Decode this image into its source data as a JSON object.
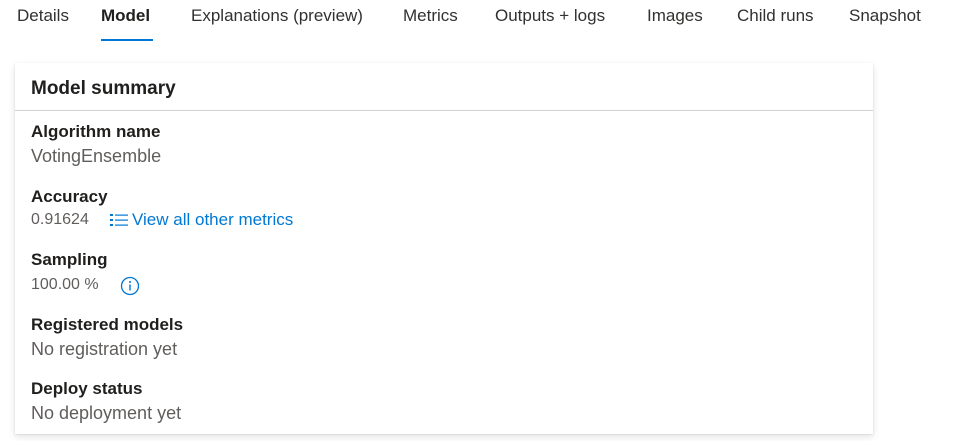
{
  "tabs": [
    {
      "label": "Details"
    },
    {
      "label": "Model"
    },
    {
      "label": "Explanations (preview)"
    },
    {
      "label": "Metrics"
    },
    {
      "label": "Outputs + logs"
    },
    {
      "label": "Images"
    },
    {
      "label": "Child runs"
    },
    {
      "label": "Snapshot"
    }
  ],
  "active_tab": "Model",
  "colors": {
    "accent": "#0078d4",
    "text": "#323130",
    "muted": "#605e5c"
  },
  "model_summary": {
    "title": "Model summary",
    "algorithm": {
      "label": "Algorithm name",
      "value": "VotingEnsemble"
    },
    "accuracy": {
      "label": "Accuracy",
      "value": "0.91624",
      "link_label": "View all other metrics",
      "link_icon": "bulleted-list-icon"
    },
    "sampling": {
      "label": "Sampling",
      "value": "100.00 %",
      "info_icon": "info-icon"
    },
    "registered_models": {
      "label": "Registered models",
      "value": "No registration yet"
    },
    "deploy_status": {
      "label": "Deploy status",
      "value": "No deployment yet"
    }
  }
}
